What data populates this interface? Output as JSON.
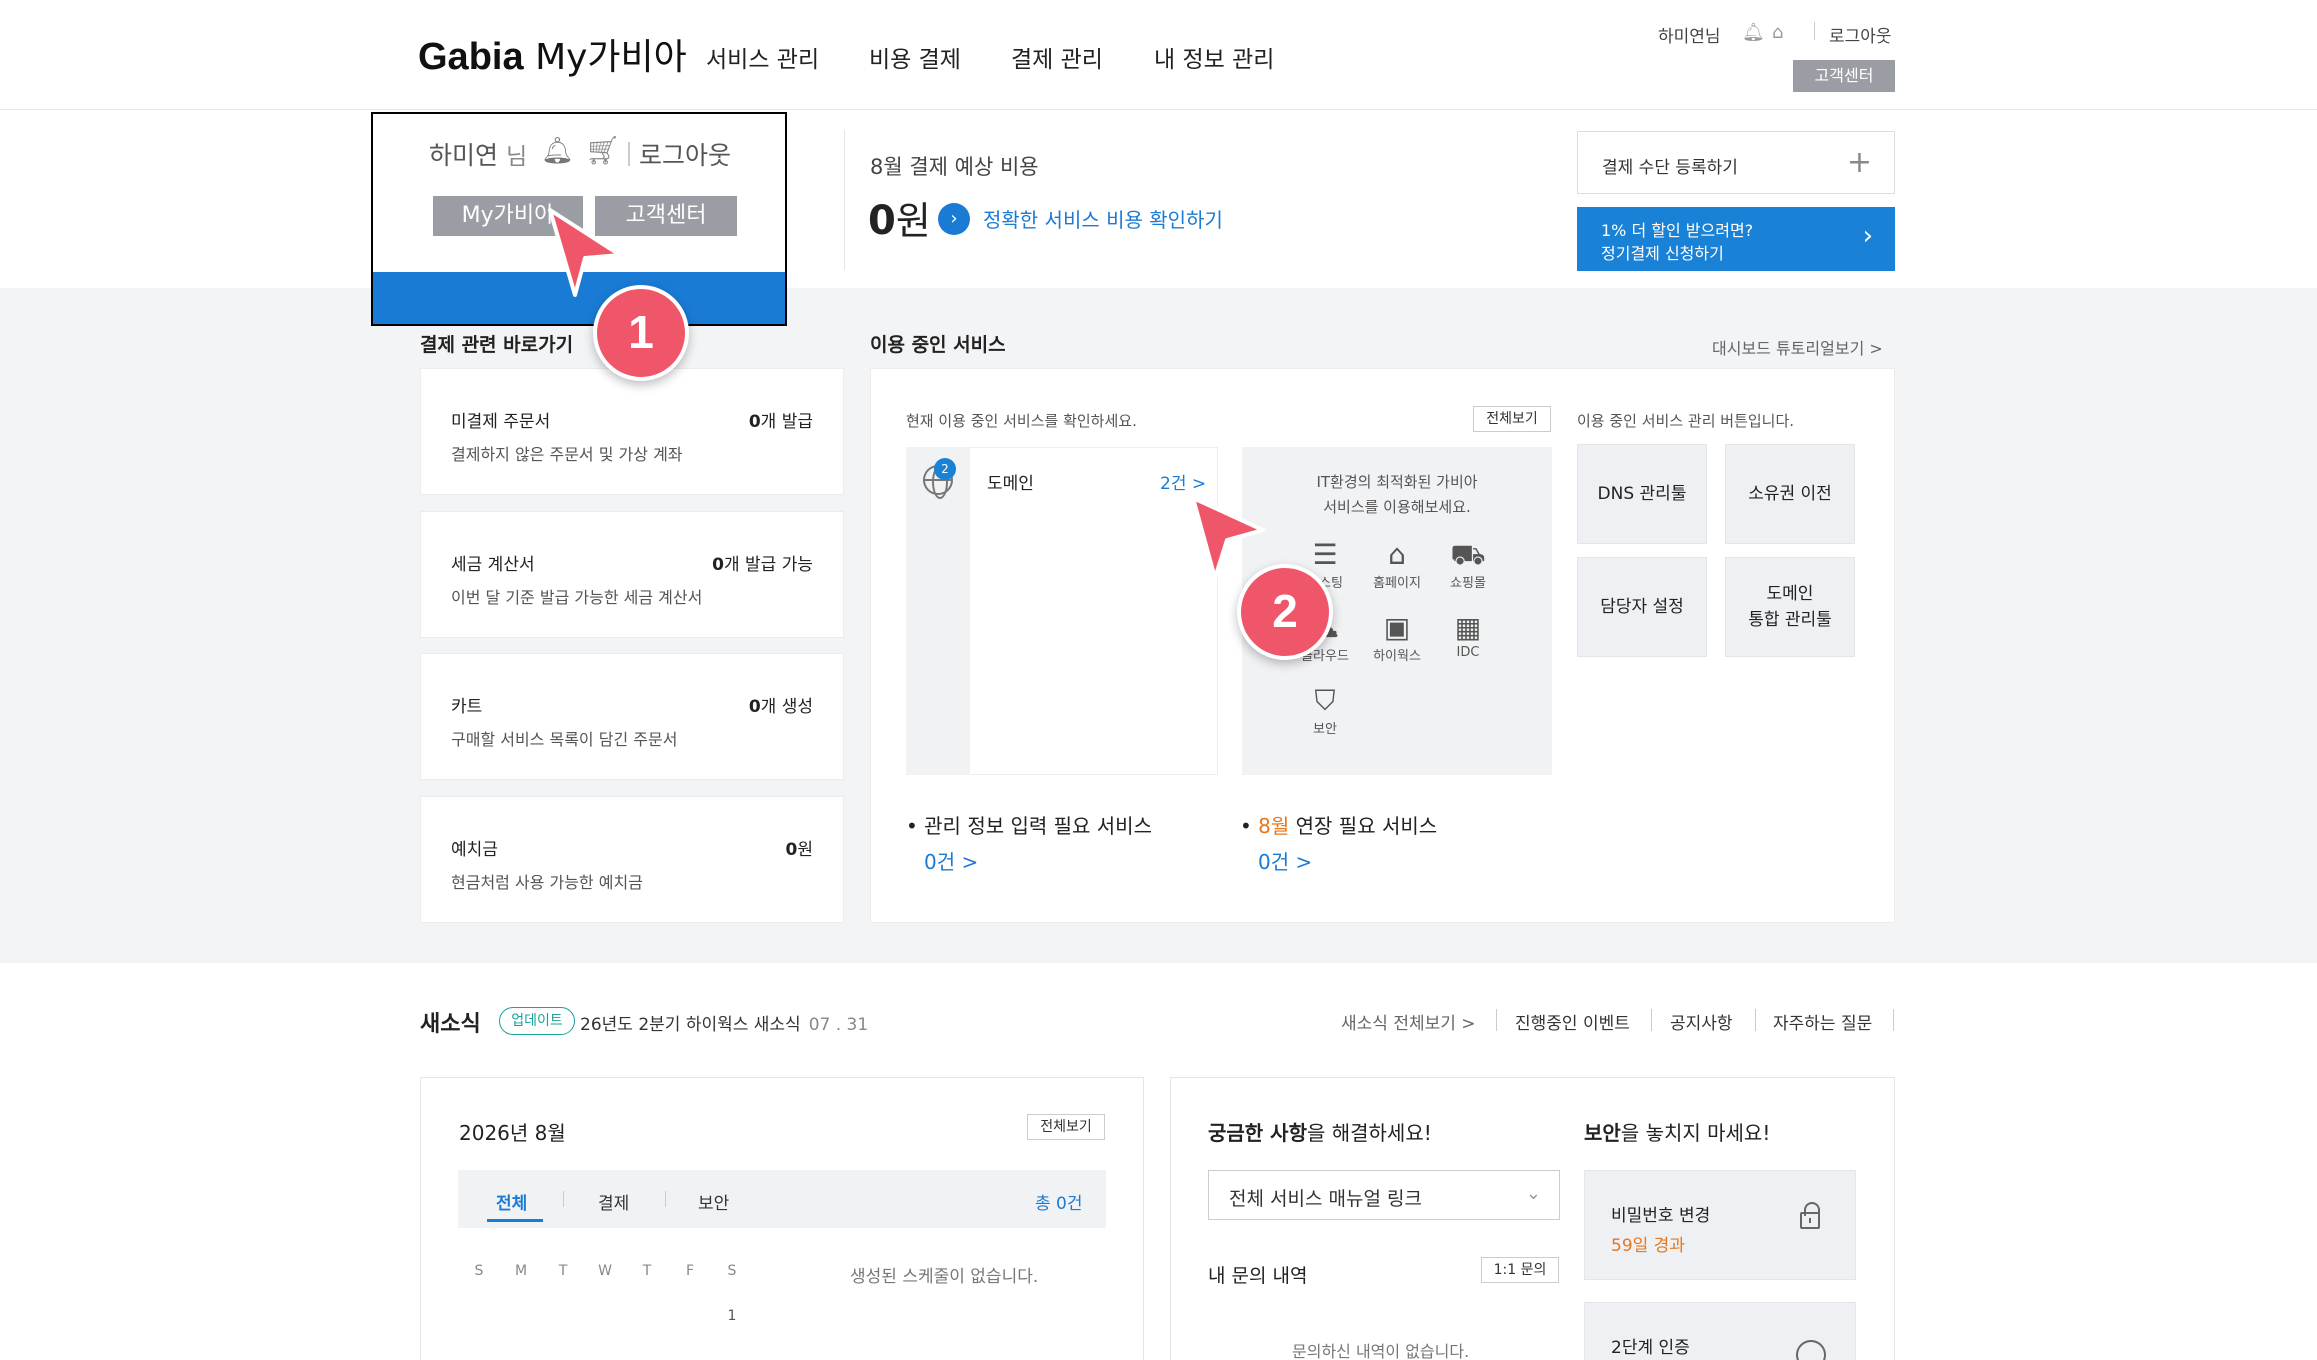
{
  "header": {
    "logo_brand": "Gabia",
    "logo_sub": "My가비아",
    "nav": [
      "서비스 관리",
      "비용 결제",
      "결제 관리",
      "내 정보 관리"
    ],
    "user": "하미연님",
    "logout": "로그아웃",
    "customer_center": "고객센터"
  },
  "summary": {
    "pay_title": "8월 결제 예상 비용",
    "pay_amount": "0",
    "pay_unit": "원",
    "pay_link": "정확한 서비스 비용 확인하기",
    "register_payment": "결제 수단 등록하기",
    "promo_line1": "1% 더 할인 받으려면?",
    "promo_line2": "정기결제 신청하기"
  },
  "shortcuts": {
    "title": "결제 관련 바로가기",
    "items": [
      {
        "name": "미결제 주문서",
        "count": "0",
        "count_suffix": "개 발급",
        "desc": "결제하지 않은 주문서 및 가상 계좌"
      },
      {
        "name": "세금 계산서",
        "count": "0",
        "count_suffix": "개 발급 가능",
        "desc": "이번 달 기준 발급 가능한 세금 계산서"
      },
      {
        "name": "카트",
        "count": "0",
        "count_suffix": "개 생성",
        "desc": "구매할 서비스 목록이 담긴 주문서"
      },
      {
        "name": "예치금",
        "count": "0",
        "count_suffix": "원",
        "desc": "현금처럼 사용 가능한 예치금"
      }
    ]
  },
  "services": {
    "title": "이용 중인 서비스",
    "tutorial_link": "대시보드 튜토리얼보기 >",
    "hint": "현재 이용 중인 서비스를 확인하세요.",
    "view_all": "전체보기",
    "domain_badge": "2",
    "domain_name": "도메인",
    "domain_count": "2건 >",
    "promo_text_1": "IT환경의 최적화된 가비아",
    "promo_text_2": "서비스를 이용해보세요.",
    "icons": [
      {
        "label": "호스팅",
        "icon": "server-icon"
      },
      {
        "label": "홈페이지",
        "icon": "home-icon"
      },
      {
        "label": "쇼핑몰",
        "icon": "cart-icon"
      },
      {
        "label": "클라우드",
        "icon": "cloud-icon"
      },
      {
        "label": "하이웍스",
        "icon": "briefcase-icon"
      },
      {
        "label": "IDC",
        "icon": "building-icon"
      },
      {
        "label": "보안",
        "icon": "shield-icon"
      }
    ],
    "mgmt_hint": "이용 중인 서비스 관리 버튼입니다.",
    "mgmt_buttons": [
      "DNS 관리툴",
      "소유권 이전",
      "담당자 설정",
      "도메인\n통합 관리툴"
    ],
    "info_needed_title": "관리 정보 입력 필요 서비스",
    "info_needed_count": "0건 >",
    "renew_month": "8월",
    "renew_title": " 연장 필요 서비스",
    "renew_count": "0건 >"
  },
  "news": {
    "title": "새소식",
    "badge": "업데이트",
    "headline": "26년도 2분기 하이웍스 새소식",
    "date": "07 . 31",
    "links": [
      "새소식 전체보기 >",
      "진행중인 이벤트",
      "공지사항",
      "자주하는 질문"
    ]
  },
  "calendar": {
    "month": "2026년 8월",
    "view_all": "전체보기",
    "tabs": [
      "전체",
      "결제",
      "보안"
    ],
    "total": "총 0건",
    "weekdays": [
      "S",
      "M",
      "T",
      "W",
      "T",
      "F",
      "S"
    ],
    "first_day": "1",
    "empty": "생성된 스케줄이 없습니다."
  },
  "help": {
    "title_bold": "궁금한 사항",
    "title_rest": "을 해결하세요!",
    "select_value": "전체 서비스 매뉴얼 링크",
    "inquiry_title": "내 문의 내역",
    "inquiry_button": "1:1 문의",
    "inquiry_empty": "문의하신 내역이 없습니다."
  },
  "security": {
    "title_bold": "보안",
    "title_rest": "을 놓치지 마세요!",
    "cards": [
      {
        "title": "비밀번호 변경",
        "status": "59일 경과"
      },
      {
        "title": "2단계 인증",
        "status": ""
      }
    ]
  },
  "zoom_overlay": {
    "user_name": "하미연",
    "user_suffix": "님",
    "logout": "로그아웃",
    "my_gabia": "My가비아",
    "customer_center": "고객센터"
  },
  "steps": [
    "1",
    "2"
  ],
  "colors": {
    "accent": "#1a7bd5",
    "step_marker": "#f0566a",
    "warning": "#e8761b",
    "badge_teal": "#1aa39b"
  }
}
